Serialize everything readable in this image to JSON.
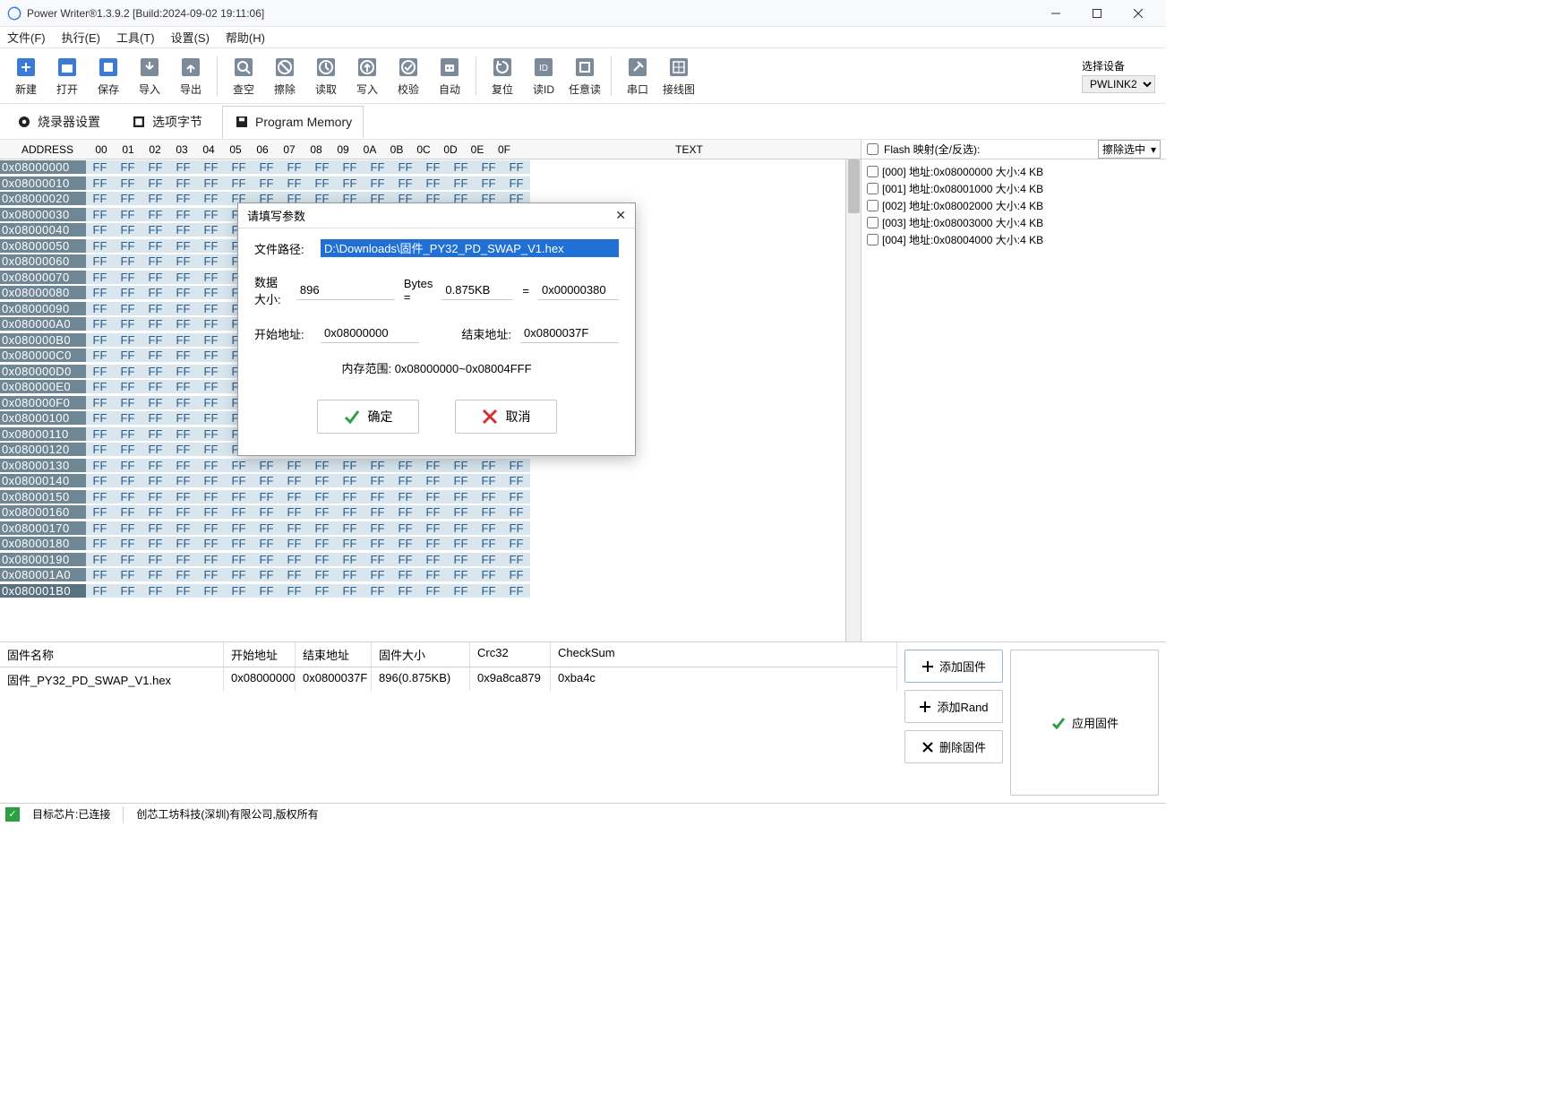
{
  "title": "Power Writer®1.3.9.2 [Build:2024-09-02 19:11:06]",
  "menu": {
    "file": "文件(F)",
    "exec": "执行(E)",
    "tool": "工具(T)",
    "set": "设置(S)",
    "help": "帮助(H)"
  },
  "toolbar": {
    "new": "新建",
    "open": "打开",
    "save": "保存",
    "import": "导入",
    "export": "导出",
    "chkblank": "查空",
    "erase": "擦除",
    "read": "读取",
    "write": "写入",
    "verify": "校验",
    "auto": "自动",
    "reset": "复位",
    "readid": "读ID",
    "anyread": "任意读",
    "serial": "串口",
    "wiring": "接线图",
    "device_label": "选择设备",
    "device": "PWLINK2"
  },
  "tabs": {
    "burner": "烧录器设置",
    "option": "选项字节",
    "memory": "Program Memory"
  },
  "hex": {
    "addr_head": "ADDRESS",
    "cols": [
      "00",
      "01",
      "02",
      "03",
      "04",
      "05",
      "06",
      "07",
      "08",
      "09",
      "0A",
      "0B",
      "0C",
      "0D",
      "0E",
      "0F"
    ],
    "text_head": "TEXT",
    "rows": [
      "0x08000000",
      "0x08000010",
      "0x08000020",
      "0x08000030",
      "0x08000040",
      "0x08000050",
      "0x08000060",
      "0x08000070",
      "0x08000080",
      "0x08000090",
      "0x080000A0",
      "0x080000B0",
      "0x080000C0",
      "0x080000D0",
      "0x080000E0",
      "0x080000F0",
      "0x08000100",
      "0x08000110",
      "0x08000120",
      "0x08000130",
      "0x08000140",
      "0x08000150",
      "0x08000160",
      "0x08000170",
      "0x08000180",
      "0x08000190",
      "0x080001A0",
      "0x080001B0"
    ],
    "byteval": "FF"
  },
  "flash": {
    "head_label": "Flash 映射(全/反选):",
    "combo": "擦除选中",
    "items": [
      "[000] 地址:0x08000000 大小:4 KB",
      "[001] 地址:0x08001000 大小:4 KB",
      "[002] 地址:0x08002000 大小:4 KB",
      "[003] 地址:0x08003000 大小:4 KB",
      "[004] 地址:0x08004000 大小:4 KB"
    ]
  },
  "fw": {
    "cols": {
      "name": "固件名称",
      "start": "开始地址",
      "end": "结束地址",
      "size": "固件大小",
      "crc": "Crc32",
      "check": "CheckSum"
    },
    "row": {
      "name": "固件_PY32_PD_SWAP_V1.hex",
      "start": "0x08000000",
      "end": "0x0800037F",
      "size": "896(0.875KB)",
      "crc": "0x9a8ca879",
      "check": "0xba4c"
    },
    "btns": {
      "add": "添加固件",
      "rand": "添加Rand",
      "del": "删除固件",
      "apply": "应用固件"
    }
  },
  "status": {
    "chip": "目标芯片:已连接",
    "copy": "创芯工坊科技(深圳)有限公司,版权所有"
  },
  "dialog": {
    "title": "请填写参数",
    "path_label": "文件路径:",
    "path": "D:\\Downloads\\固件_PY32_PD_SWAP_V1.hex",
    "size_label": "数据大小:",
    "size_bytes": "896",
    "bytes_eq": "Bytes =",
    "size_kb": "0.875KB",
    "eq": "=",
    "size_hex": "0x00000380",
    "start_label": "开始地址:",
    "start": "0x08000000",
    "end_label": "结束地址:",
    "end": "0x0800037F",
    "mem_label": "内存范围:",
    "mem": "0x08000000~0x08004FFF",
    "ok": "确定",
    "cancel": "取消"
  }
}
